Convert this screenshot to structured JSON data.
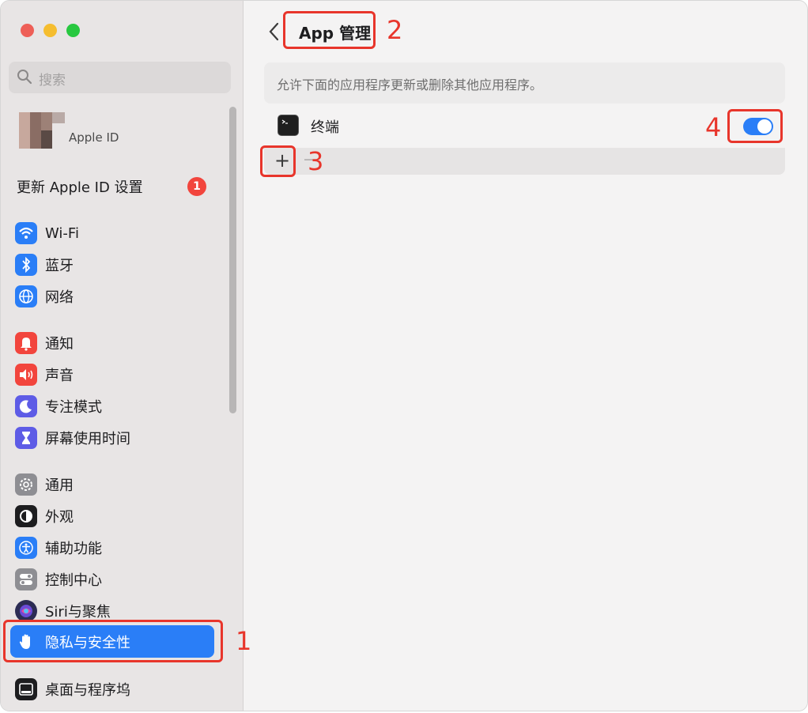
{
  "sidebar": {
    "search_placeholder": "搜索",
    "apple_id_label": "Apple ID",
    "update_label": "更新 Apple ID 设置",
    "update_badge": "1",
    "items": [
      {
        "label": "Wi-Fi",
        "icon": "wifi-icon",
        "color": "#2a7ef7"
      },
      {
        "label": "蓝牙",
        "icon": "bluetooth-icon",
        "color": "#2a7ef7"
      },
      {
        "label": "网络",
        "icon": "globe-icon",
        "color": "#2a7ef7"
      },
      {
        "label": "通知",
        "icon": "bell-icon",
        "color": "#f2453d"
      },
      {
        "label": "声音",
        "icon": "speaker-icon",
        "color": "#f2453d"
      },
      {
        "label": "专注模式",
        "icon": "moon-icon",
        "color": "#5e5ce6"
      },
      {
        "label": "屏幕使用时间",
        "icon": "hourglass-icon",
        "color": "#5e5ce6"
      },
      {
        "label": "通用",
        "icon": "gear-icon",
        "color": "#8e8e93"
      },
      {
        "label": "外观",
        "icon": "appearance-icon",
        "color": "#1d1d1f"
      },
      {
        "label": "辅助功能",
        "icon": "accessibility-icon",
        "color": "#2a7ef7"
      },
      {
        "label": "控制中心",
        "icon": "control-center-icon",
        "color": "#8e8e93"
      },
      {
        "label": "Siri与聚焦",
        "icon": "siri-icon",
        "color": "#2c2c54"
      },
      {
        "label": "隐私与安全性",
        "icon": "hand-icon",
        "color": "#2a7ef7",
        "selected": true
      },
      {
        "label": "桌面与程序坞",
        "icon": "dock-icon",
        "color": "#1d1d1f"
      }
    ]
  },
  "main": {
    "title": "App 管理",
    "description": "允许下面的应用程序更新或删除其他应用程序。",
    "apps": [
      {
        "name": "终端",
        "enabled": true
      }
    ],
    "add_label": "+",
    "remove_label": "−"
  },
  "annotations": [
    "1",
    "2",
    "3",
    "4"
  ]
}
